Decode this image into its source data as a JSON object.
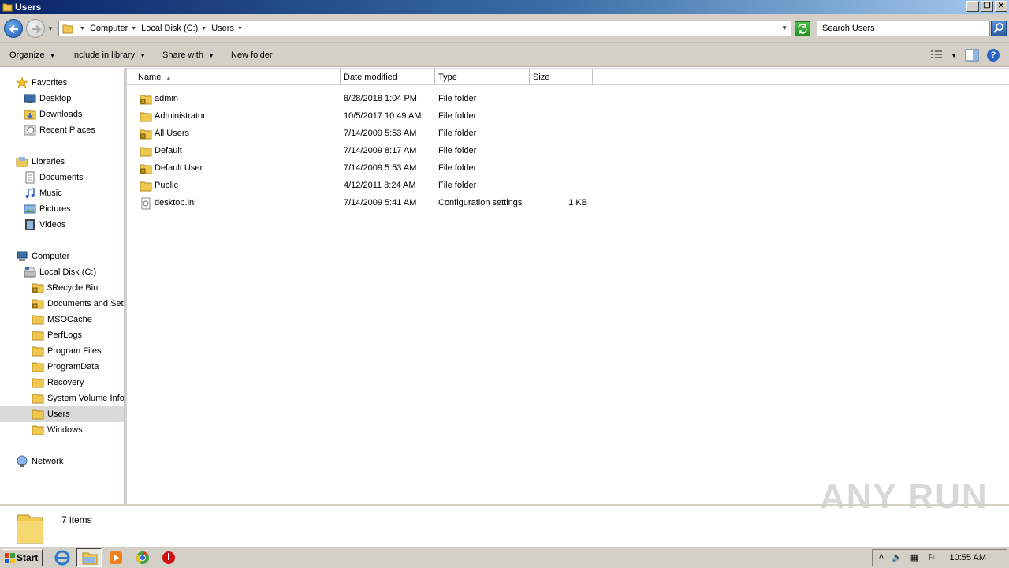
{
  "window": {
    "title": "Users"
  },
  "address": {
    "crumbs": [
      "Computer",
      "Local Disk (C:)",
      "Users"
    ],
    "search_placeholder": "Search Users"
  },
  "commands": {
    "organize": "Organize",
    "include_in_library": "Include in library",
    "share_with": "Share with",
    "new_folder": "New folder"
  },
  "nav": {
    "favorites": "Favorites",
    "desktop": "Desktop",
    "downloads": "Downloads",
    "recent_places": "Recent Places",
    "libraries": "Libraries",
    "documents": "Documents",
    "music": "Music",
    "pictures": "Pictures",
    "videos": "Videos",
    "computer": "Computer",
    "local_disk": "Local Disk (C:)",
    "recycle_bin": "$Recycle.Bin",
    "documents_and_settings": "Documents and Sett",
    "msocache": "MSOCache",
    "perflogs": "PerfLogs",
    "program_files": "Program Files",
    "programdata": "ProgramData",
    "recovery": "Recovery",
    "system_volume": "System Volume Infor",
    "users": "Users",
    "windows": "Windows",
    "network": "Network"
  },
  "columns": {
    "name": "Name",
    "date": "Date modified",
    "type": "Type",
    "size": "Size"
  },
  "files": [
    {
      "name": "admin",
      "date": "8/28/2018 1:04 PM",
      "type": "File folder",
      "size": "",
      "icon": "locked-folder-icon"
    },
    {
      "name": "Administrator",
      "date": "10/5/2017 10:49 AM",
      "type": "File folder",
      "size": "",
      "icon": "folder-icon"
    },
    {
      "name": "All Users",
      "date": "7/14/2009 5:53 AM",
      "type": "File folder",
      "size": "",
      "icon": "locked-folder-icon"
    },
    {
      "name": "Default",
      "date": "7/14/2009 8:17 AM",
      "type": "File folder",
      "size": "",
      "icon": "folder-icon"
    },
    {
      "name": "Default User",
      "date": "7/14/2009 5:53 AM",
      "type": "File folder",
      "size": "",
      "icon": "locked-folder-icon"
    },
    {
      "name": "Public",
      "date": "4/12/2011 3:24 AM",
      "type": "File folder",
      "size": "",
      "icon": "folder-icon"
    },
    {
      "name": "desktop.ini",
      "date": "7/14/2009 5:41 AM",
      "type": "Configuration settings",
      "size": "1 KB",
      "icon": "settings-file-icon"
    }
  ],
  "status": {
    "items": "7 items"
  },
  "watermark": "ANY RUN",
  "taskbar": {
    "start": "Start",
    "clock": "10:55 AM"
  }
}
